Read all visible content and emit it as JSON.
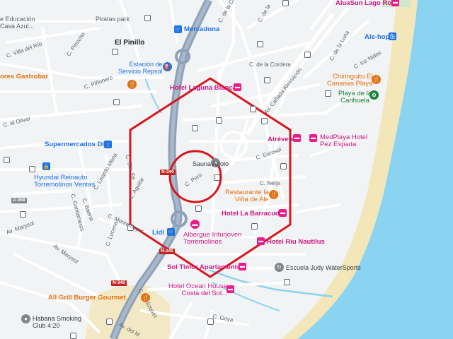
{
  "colors": {
    "water": "#8ad4f2",
    "beach": "#f3e6b8",
    "road_main": "#8ea2b9",
    "overlay": "#d6171d"
  },
  "places": {
    "el_pinillo": "El Pinillo",
    "piratas_park": "Piratas park",
    "educacion": "e Educación",
    "casa_azul": "Casa Azul..."
  },
  "streets": {
    "villa_del_rio": "C. Villa del Río",
    "pinocho": "C. Pinocho",
    "pinonero": "C. Piñonero",
    "el_olivar": "C. el Olivar",
    "de_la_cordera": "C. de la Cordera",
    "de_la_luna": "C. de la Luna",
    "los_nidos": "C. los Nidos",
    "canada_alessandri": "Av. Cañada Alessandri",
    "eurosol": "C. Eurosol",
    "nerja": "C. Nerja",
    "peru": "C. Perú",
    "aguilar": "C. Aguilar",
    "lisardo_mena": "C. Lisardo Mena",
    "sta_fe": "C. Sta. Fe",
    "baena": "C. Baena",
    "lucena": "C. Lucena",
    "montemayor": "C. Montemayor",
    "cantarranas": "C. Cantarranas",
    "marysol1": "Av. Marysol",
    "marysol2": "Av. Marysol",
    "velazquez": "C. Velázquez",
    "goya": "C. Goya",
    "av_del_m": "Av. del M",
    "c_top": "C. de la Cor",
    "c_mid": "C. de la"
  },
  "shields": {
    "n340a": "N-340",
    "n340b": "N-340",
    "n340c": "N-340",
    "a368": "A-368"
  },
  "pois": {
    "mercadona": "Mercadona",
    "repsol": "Estación de\nServicio Repsol",
    "gastrobar": "ores Gastrobar",
    "laguna": "Hotel Laguna Blanca",
    "supermercados_dia": "Supermercados Dia",
    "hyundai": "Hyundai Reinauto\nTorremolinos Ventas",
    "sauna": "Sauna Apolo",
    "atrevete": "Atrévete",
    "medplaya": "MedPlaya Hotel\nPez Espada",
    "vina": "Restaurante la\nViña de Ale",
    "barracuda": "Hotel La Barracuda",
    "lidl": "Lidl",
    "albergue": "Albergue Inturjoven\nTorremolinos",
    "riu": "Hotel Riu Nautilus",
    "sol_timor": "Sol Timor Apartamentos",
    "judy": "Escuela Judy WaterSports",
    "ocean_house": "Hotel Ocean House\nCosta del Sol...",
    "all_grill": "All Grill Burger Gourmet",
    "habana": "Habana Smoking\nClub 4:20",
    "alehop": "Ale-hop",
    "alusun": "AluaSun Lago Rojo",
    "chiringuito": "Chiringuito El\nCanarias Playa",
    "playa_carihuela": "Playa de la\nCarihuela"
  }
}
